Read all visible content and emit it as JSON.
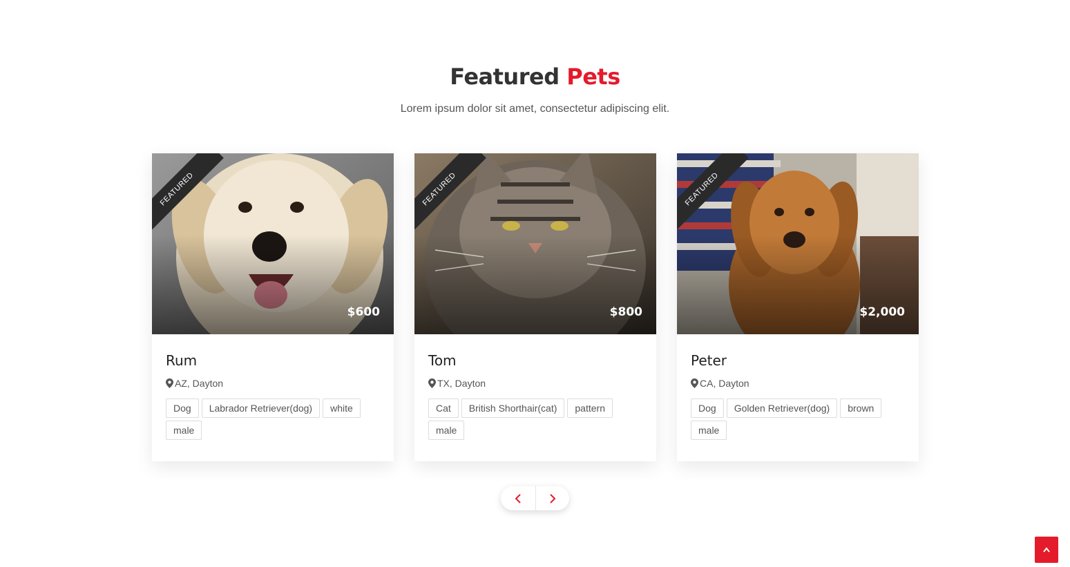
{
  "section": {
    "title_main": "Featured",
    "title_accent": "Pets",
    "subtitle": "Lorem ipsum dolor sit amet, consectetur adipiscing elit."
  },
  "pets": [
    {
      "ribbon": "FEATURED",
      "price": "$600",
      "name": "Rum",
      "location": "AZ, Dayton",
      "tags": [
        "Dog",
        "Labrador Retriever(dog)",
        "white",
        "male"
      ],
      "image": "labrador-retriever-photo"
    },
    {
      "ribbon": "FEATURED",
      "price": "$800",
      "name": "Tom",
      "location": "TX, Dayton",
      "tags": [
        "Cat",
        "British Shorthair(cat)",
        "pattern",
        "male"
      ],
      "image": "tabby-cat-photo"
    },
    {
      "ribbon": "FEATURED",
      "price": "$2,000",
      "name": "Peter",
      "location": "CA, Dayton",
      "tags": [
        "Dog",
        "Golden Retriever(dog)",
        "brown",
        "male"
      ],
      "image": "golden-retriever-photo"
    }
  ],
  "carousel_nav": {
    "prev_icon": "chevron-left-icon",
    "next_icon": "chevron-right-icon"
  },
  "scroll_top": {
    "icon": "chevron-up-icon"
  },
  "colors": {
    "accent": "#e31b2b",
    "ribbon": "#2a2a2a",
    "text": "#333333"
  }
}
